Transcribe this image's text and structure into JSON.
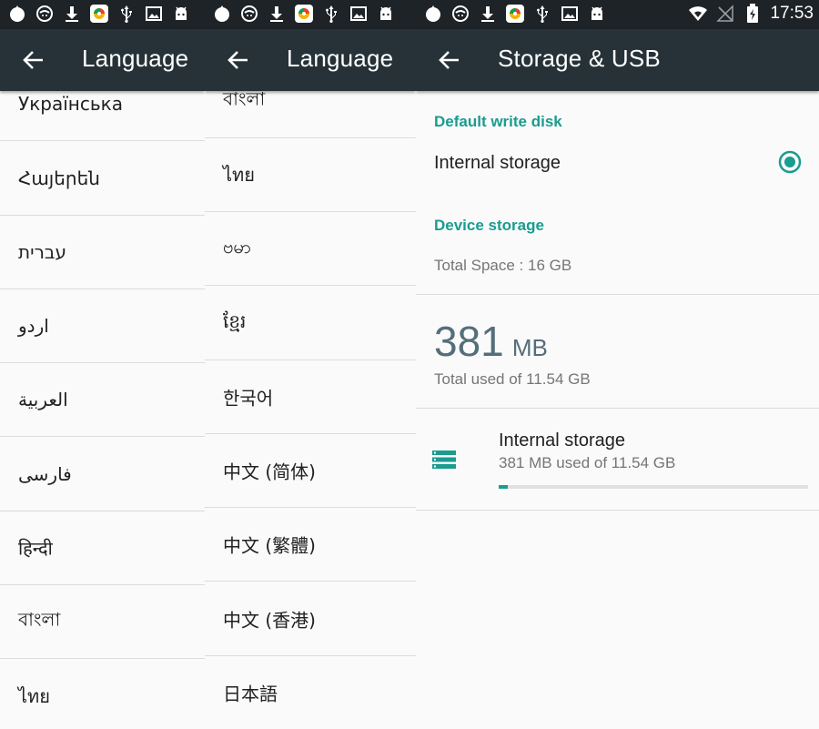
{
  "status_bar": {
    "time": "17:53"
  },
  "panels": [
    {
      "title": "Language",
      "languages": [
        "Українська",
        "Հայերեն",
        "עברית",
        "اردو",
        "العربية",
        "فارسی",
        "हिन्दी",
        "বাংলা",
        "ไทย"
      ]
    },
    {
      "title": "Language",
      "languages": [
        "বাংলা",
        "ไทย",
        "ဗမာ",
        "ខ្មែរ",
        "한국어",
        "中文 (简体)",
        "中文 (繁體)",
        "中文 (香港)",
        "日本語"
      ]
    }
  ],
  "storage": {
    "title": "Storage & USB",
    "default_write_disk_header": "Default write disk",
    "default_disk_option": "Internal storage",
    "default_disk_selected": true,
    "device_storage_header": "Device storage",
    "total_space": "Total Space : 16 GB",
    "used_value": "381",
    "used_unit": "MB",
    "used_caption": "Total used of 11.54 GB",
    "volume": {
      "name": "Internal storage",
      "summary": "381 MB used of 11.54 GB",
      "used_fraction": 0.03
    }
  },
  "colors": {
    "accent": "#1a9c8f",
    "appbar": "#263238",
    "statusbar": "#1e2327",
    "progress_track": "#e0e0e0"
  }
}
